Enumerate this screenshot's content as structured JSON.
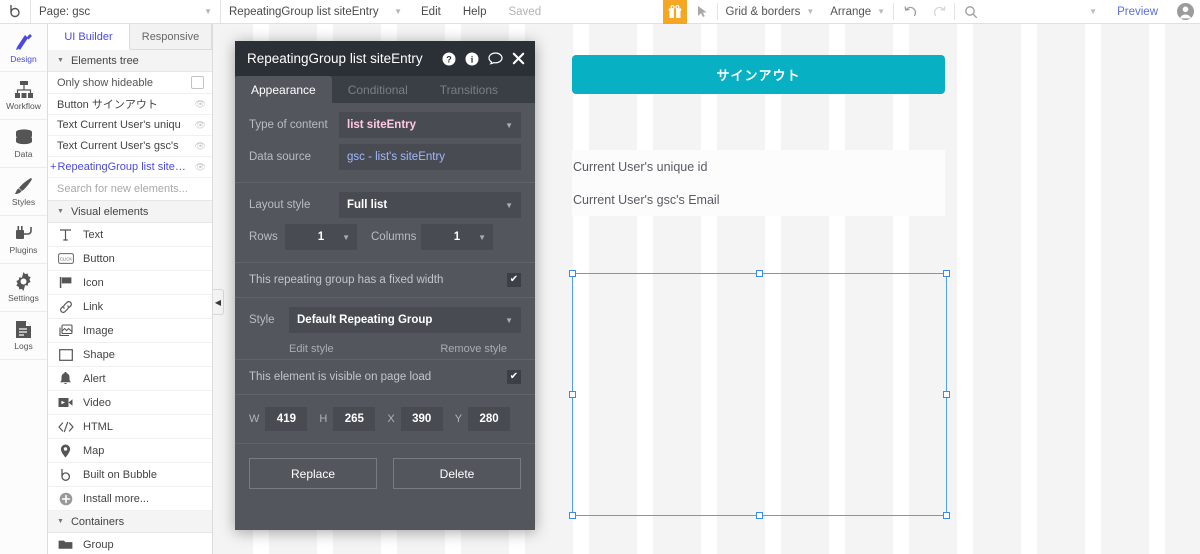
{
  "topbar": {
    "logo": "bubble-logo-icon",
    "page_selector": {
      "label": "Page: gsc",
      "caret": "caret-down-icon"
    },
    "element_selector": {
      "label": "RepeatingGroup list siteEntry",
      "caret": "caret-down-icon"
    },
    "edit": "Edit",
    "help": "Help",
    "saved": "Saved",
    "gift": "gift-icon",
    "pointer": "pointer-icon",
    "grid_borders": "Grid & borders",
    "arrange": "Arrange",
    "undo": "undo-icon",
    "redo": "redo-icon",
    "search": "search-icon",
    "preview": "Preview",
    "avatar": "user-avatar-icon"
  },
  "rail": {
    "items": [
      {
        "label": "Design",
        "icon": "design-icon",
        "active": true
      },
      {
        "label": "Workflow",
        "icon": "workflow-icon",
        "active": false
      },
      {
        "label": "Data",
        "icon": "database-icon",
        "active": false
      },
      {
        "label": "Styles",
        "icon": "brush-icon",
        "active": false
      },
      {
        "label": "Plugins",
        "icon": "plug-icon",
        "active": false
      },
      {
        "label": "Settings",
        "icon": "gear-icon",
        "active": false
      },
      {
        "label": "Logs",
        "icon": "document-icon",
        "active": false
      }
    ]
  },
  "panel": {
    "tabs": [
      {
        "label": "UI Builder",
        "active": true
      },
      {
        "label": "Responsive",
        "active": false
      }
    ],
    "elements_tree": {
      "title": "Elements tree",
      "only_show_hideable": "Only show hideable",
      "checked": false,
      "items": [
        {
          "label": "Button サインアウト",
          "selected": false,
          "expander": ""
        },
        {
          "label": "Text Current User's uniqu",
          "selected": false,
          "expander": ""
        },
        {
          "label": "Text Current User's gsc's",
          "selected": false,
          "expander": ""
        },
        {
          "label": "RepeatingGroup list siteEnt...",
          "selected": true,
          "expander": "+"
        }
      ],
      "search_placeholder": "Search for new elements..."
    },
    "visual_elements": {
      "title": "Visual elements",
      "items": [
        {
          "label": "Text",
          "icon": "text-icon"
        },
        {
          "label": "Button",
          "icon": "button-icon"
        },
        {
          "label": "Icon",
          "icon": "flag-icon"
        },
        {
          "label": "Link",
          "icon": "link-icon"
        },
        {
          "label": "Image",
          "icon": "image-icon"
        },
        {
          "label": "Shape",
          "icon": "shape-icon"
        },
        {
          "label": "Alert",
          "icon": "bell-icon"
        },
        {
          "label": "Video",
          "icon": "video-icon"
        },
        {
          "label": "HTML",
          "icon": "code-icon"
        },
        {
          "label": "Map",
          "icon": "map-pin-icon"
        },
        {
          "label": "Built on Bubble",
          "icon": "bubble-icon"
        },
        {
          "label": "Install more...",
          "icon": "plus-circle-icon"
        }
      ]
    },
    "containers": {
      "title": "Containers",
      "items": [
        {
          "label": "Group",
          "icon": "folder-icon"
        }
      ]
    },
    "collapse": "collapse-left-icon"
  },
  "canvas": {
    "signout_button": "サインアウト",
    "text_elements": [
      "Current User's unique id",
      "Current User's gsc's Email"
    ],
    "selection": {
      "handles": 8
    }
  },
  "property_editor": {
    "title": "RepeatingGroup list siteEntry",
    "header_icons": [
      "help-circle-icon",
      "info-circle-icon",
      "comment-icon",
      "close-icon"
    ],
    "tabs": [
      {
        "label": "Appearance",
        "active": true
      },
      {
        "label": "Conditional",
        "active": false
      },
      {
        "label": "Transitions",
        "active": false
      }
    ],
    "type_of_content": {
      "label": "Type of content",
      "value": "list siteEntry"
    },
    "data_source": {
      "label": "Data source",
      "value": "gsc - list's siteEntry"
    },
    "layout_style": {
      "label": "Layout style",
      "value": "Full list"
    },
    "rows": {
      "label": "Rows",
      "value": "1"
    },
    "columns": {
      "label": "Columns",
      "value": "1"
    },
    "fixed_width": {
      "label": "This repeating group has a fixed width",
      "checked": true
    },
    "style": {
      "label": "Style",
      "value": "Default Repeating Group"
    },
    "edit_style": "Edit style",
    "remove_style": "Remove style",
    "visible_on_load": {
      "label": "This element is visible on page load",
      "checked": true
    },
    "dims": [
      {
        "label": "W",
        "value": "419"
      },
      {
        "label": "H",
        "value": "265"
      },
      {
        "label": "X",
        "value": "390"
      },
      {
        "label": "Y",
        "value": "280"
      }
    ],
    "replace": "Replace",
    "delete": "Delete"
  },
  "colors": {
    "accent_teal": "#08b0c4",
    "brand_blue": "#4a4ae0",
    "gift_orange": "#f5a623",
    "selection_blue": "#3b8ae8",
    "editor_bg": "#53575d",
    "editor_header": "#2b3036"
  }
}
